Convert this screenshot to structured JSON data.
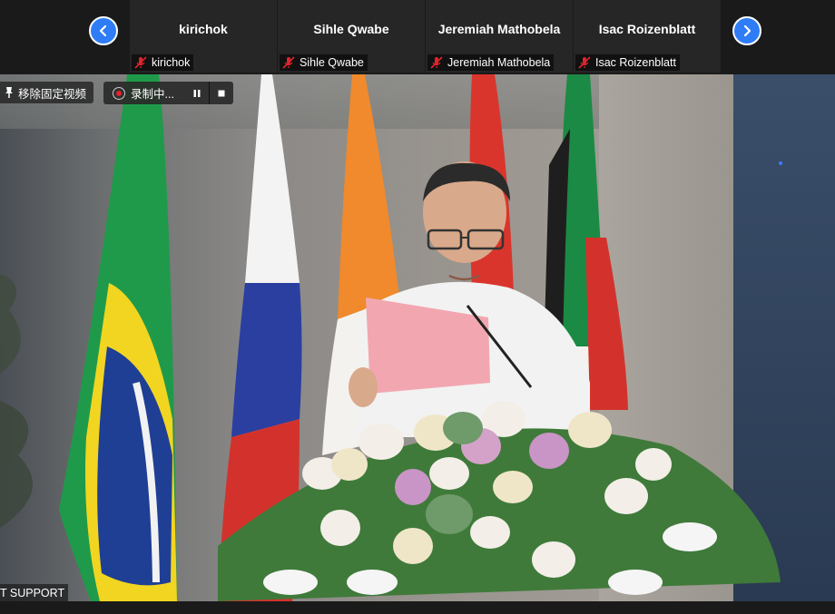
{
  "participants": [
    {
      "name": "kirichok",
      "label": "kirichok"
    },
    {
      "name": "Sihle Qwabe",
      "label": "Sihle Qwabe"
    },
    {
      "name": "Jeremiah  Mathobela",
      "label": "Jeremiah Mathobela"
    },
    {
      "name": "Isac Roizenblatt",
      "label": "Isac Roizenblatt"
    }
  ],
  "controls": {
    "unpin_label": "移除固定视频",
    "recording_label": "录制中..."
  },
  "main_video": {
    "speaker_label": "T SUPPORT"
  },
  "icons": {
    "prev": "chevron-left-icon",
    "next": "chevron-right-icon",
    "mic": "mic-muted-icon",
    "pin": "pin-icon",
    "pause": "pause-icon",
    "stop": "stop-icon"
  },
  "colors": {
    "accent_blue": "#2f7df6",
    "muted_red": "#e0242c",
    "tile_bg": "#262626"
  }
}
